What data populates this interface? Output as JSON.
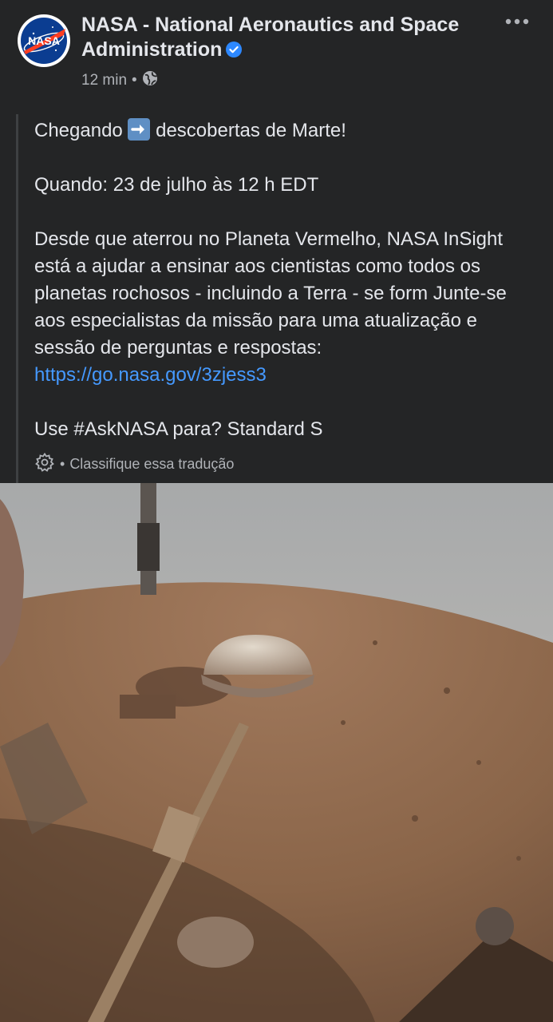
{
  "post": {
    "page_name": "NASA - National Aeronautics and Space Administration",
    "logo_text": "NASA",
    "time": "12 min",
    "separator": "•",
    "audience_icon": "globe-icon",
    "verified_icon": "verified-badge-icon",
    "menu_icon": "more-options-icon",
    "text": {
      "line1_before": "Chegando",
      "line1_after": "descobertas de Marte!",
      "arrow_icon": "right-arrow-emoji",
      "when": "Quando: 23 de julho às 12 h EDT",
      "body": "Desde que aterrou no Planeta Vermelho, NASA InSight está a ajudar a ensinar aos cientistas como todos os planetas rochosos - incluindo a Terra - se form Junte-se aos especialistas da missão para uma atualização e sessão de perguntas e respostas:",
      "link": "https://go.nasa.gov/3zjess3",
      "closing": "Use #AskNASA para? Standard S"
    },
    "translation": {
      "icon": "gear-icon",
      "separator": "•",
      "label": "Classifique essa tradução"
    }
  },
  "colors": {
    "background": "#242526",
    "text": "#e4e6eb",
    "secondary_text": "#b0b3b8",
    "link": "#4599ff",
    "verified": "#2d88ff"
  }
}
